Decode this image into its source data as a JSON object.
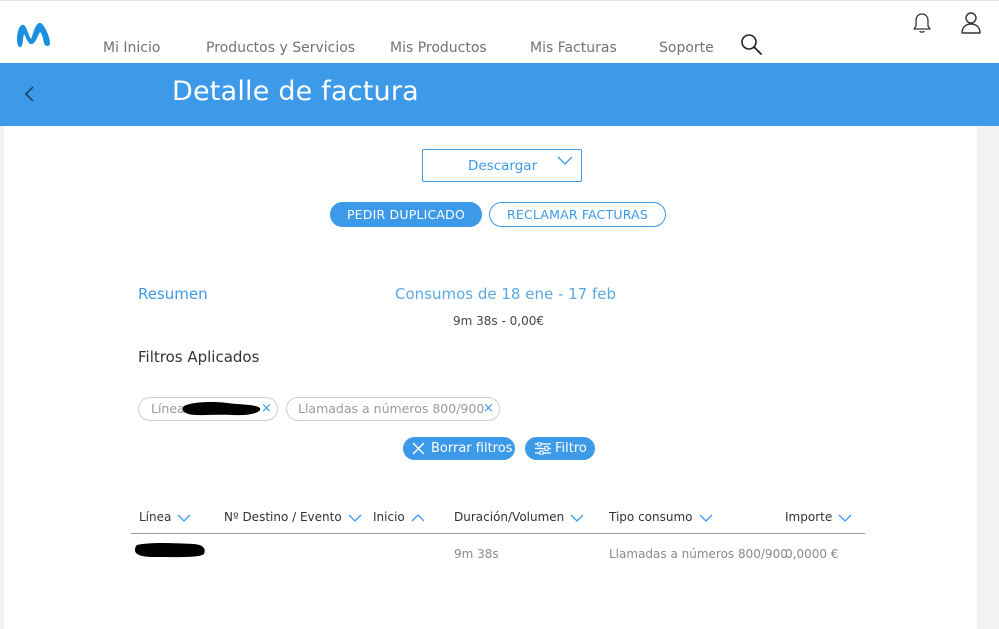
{
  "nav": {
    "items": [
      "Mi Inicio",
      "Productos y Servicios",
      "Mis Productos",
      "Mis Facturas",
      "Soporte"
    ],
    "icons": {
      "logo": "movistar-m-logo",
      "search": "search-icon",
      "bell": "bell-icon",
      "user": "user-icon"
    }
  },
  "header": {
    "title": "Detalle de factura"
  },
  "download": {
    "label": "Descargar"
  },
  "actions": {
    "duplicate": "PEDIR DUPLICADO",
    "claim": "RECLAMAR FACTURAS"
  },
  "summary": {
    "label": "Resumen",
    "period": "Consumos de 18 ene - 17 feb",
    "total": "9m 38s - 0,00€"
  },
  "filters": {
    "title": "Filtros Aplicados",
    "chips": [
      {
        "label": "Línea"
      },
      {
        "label": "Llamadas a números 800/900"
      }
    ],
    "clear_label": "Borrar filtros",
    "filter_label": "Filtro"
  },
  "table": {
    "columns": [
      "Línea",
      "Nº Destino / Evento",
      "Inicio",
      "Duración/Volumen",
      "Tipo consumo",
      "Importe"
    ],
    "rows": [
      {
        "duration": "9m 38s",
        "type": "Llamadas a números 800/900",
        "amount": "0,0000 €"
      }
    ]
  },
  "colors": {
    "accent": "#3c9ae8",
    "redaction": "#000000"
  }
}
